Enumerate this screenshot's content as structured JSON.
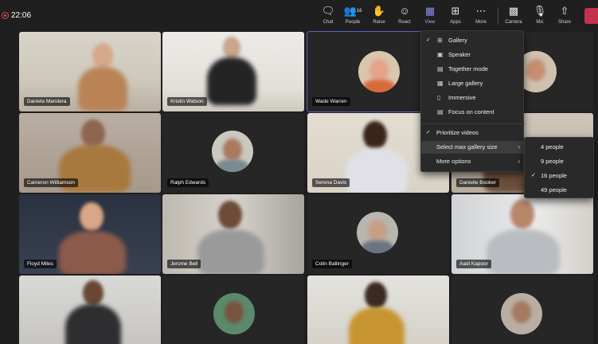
{
  "meeting": {
    "timer": "22:06"
  },
  "toolbar": {
    "chat": "Chat",
    "people": "People",
    "people_count": "16",
    "raise": "Raise",
    "react": "React",
    "view": "View",
    "apps": "Apps",
    "more": "More",
    "camera": "Camera",
    "mic": "Mic",
    "share": "Share"
  },
  "participants": [
    "Daniela Mandera",
    "Kristin Watson",
    "Wade Warren",
    "Cameron Williamson",
    "Ralph Edwards",
    "Serena Davis",
    "Danielle Booker",
    "Floyd Miles",
    "Jerome Bell",
    "Colin Ballinger",
    "Aadi Kapoor"
  ],
  "view_menu": {
    "items": [
      "Gallery",
      "Speaker",
      "Together mode",
      "Large gallery",
      "Immersive",
      "Focus on content"
    ],
    "prioritize": "Prioritize videos",
    "max_size": "Select max gallery size",
    "more_options": "More options"
  },
  "gallery_size_menu": {
    "options": [
      "4 people",
      "9 people",
      "16 people",
      "49 people"
    ],
    "selected": "16 people"
  },
  "colors": {
    "accent": "#5b5fc7",
    "leave": "#c4314b",
    "background": "#1f1f1f"
  }
}
